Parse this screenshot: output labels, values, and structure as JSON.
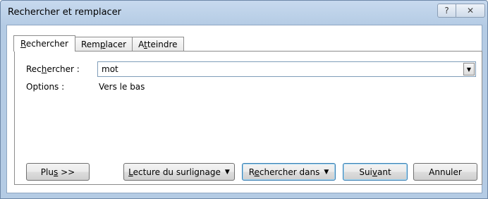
{
  "window": {
    "title": "Rechercher et remplacer",
    "help_glyph": "?",
    "close_glyph": "✕"
  },
  "tabs": [
    {
      "label_pre": "",
      "label_u": "R",
      "label_post": "echercher",
      "active": true
    },
    {
      "label_pre": "Rem",
      "label_u": "p",
      "label_post": "lacer",
      "active": false
    },
    {
      "label_pre": "A",
      "label_u": "t",
      "label_post": "teindre",
      "active": false
    }
  ],
  "find": {
    "label_pre": "Rec",
    "label_u": "h",
    "label_post": "ercher :",
    "value": "mot"
  },
  "options": {
    "label": "Options :",
    "value": "Vers le bas"
  },
  "buttons": {
    "more": {
      "pre": "Plu",
      "u": "s",
      "post": " >>"
    },
    "reading_highlight": {
      "pre": "",
      "u": "L",
      "post": "ecture du surlignage"
    },
    "find_in": {
      "pre": "R",
      "u": "e",
      "post": "chercher dans"
    },
    "next": {
      "pre": "Sui",
      "u": "v",
      "post": "ant"
    },
    "cancel": "Annuler"
  }
}
